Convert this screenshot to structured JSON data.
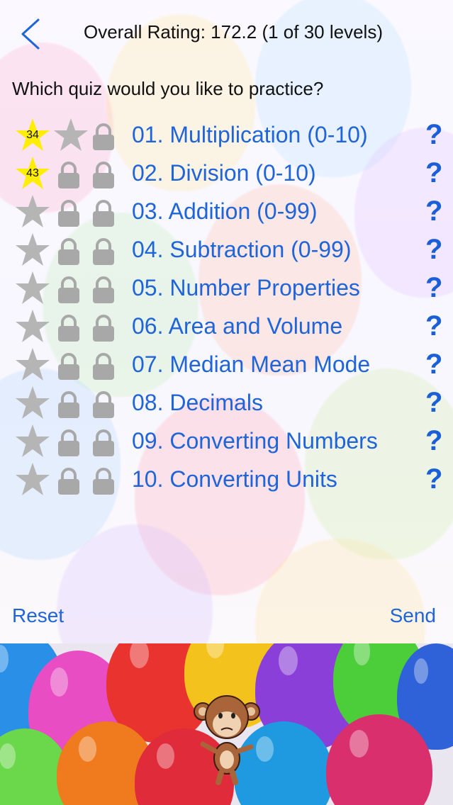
{
  "header": {
    "title": "Overall Rating: 172.2 (1 of 30 levels)"
  },
  "prompt": "Which quiz would you like to practice?",
  "quizzes": [
    {
      "label": "01. Multiplication (0-10)",
      "score": "34"
    },
    {
      "label": "02. Division (0-10)",
      "score": "43"
    },
    {
      "label": "03. Addition (0-99)",
      "score": ""
    },
    {
      "label": "04. Subtraction (0-99)",
      "score": ""
    },
    {
      "label": "05. Number Properties",
      "score": ""
    },
    {
      "label": "06. Area and Volume",
      "score": ""
    },
    {
      "label": "07. Median Mean Mode",
      "score": ""
    },
    {
      "label": "08. Decimals",
      "score": ""
    },
    {
      "label": "09. Converting Numbers",
      "score": ""
    },
    {
      "label": "10. Converting Units",
      "score": ""
    }
  ],
  "help_glyph": "?",
  "footer": {
    "reset": "Reset",
    "send": "Send"
  },
  "colors": {
    "link": "#1f64d8",
    "star_earned": "#ffee00",
    "star_locked": "#b5b5b5",
    "lock": "#a8a8a8"
  }
}
